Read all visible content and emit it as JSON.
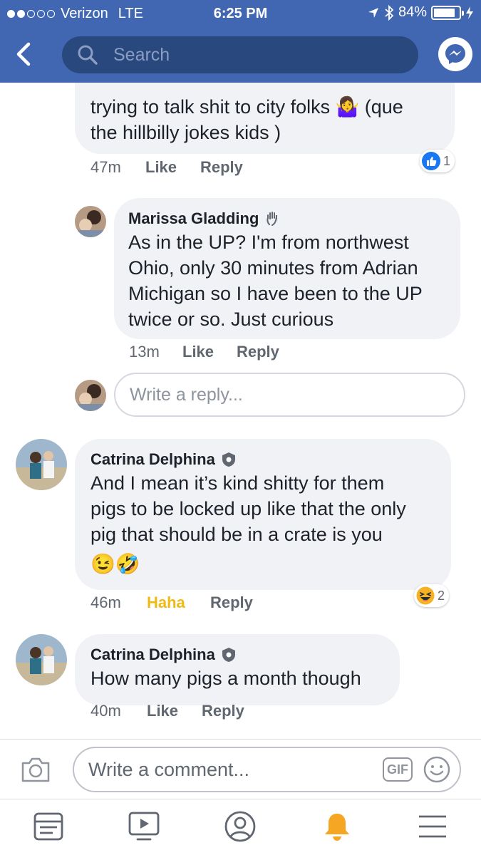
{
  "status_bar": {
    "carrier": "Verizon",
    "network": "LTE",
    "time": "6:25 PM",
    "battery": "84%",
    "battery_level": 0.84
  },
  "search": {
    "placeholder": "Search"
  },
  "comments": [
    {
      "id": "partial",
      "text_line1": "trying to talk shit to city folks 🤷‍♀️ (que",
      "text_line2": "the hillbilly jokes kids )",
      "time": "47m",
      "like_label": "Like",
      "reply_label": "Reply",
      "reaction_icon": "like-icon",
      "reaction_count": "1"
    },
    {
      "id": "marissa",
      "author": "Marissa Gladding",
      "author_badge": "wave-hand-icon",
      "text_lines": [
        "As in the UP? I'm from northwest",
        "Ohio, only 30 minutes from Adrian",
        "Michigan so I have been to the UP",
        "twice or so. Just curious"
      ],
      "time": "13m",
      "like_label": "Like",
      "reply_label": "Reply"
    },
    {
      "id": "catrina1",
      "author": "Catrina Delphina",
      "author_badge": "verified-shield-icon",
      "text_lines": [
        "And I mean it’s kind shitty for them",
        "pigs to be locked up like that the only",
        "pig that should be in a crate is you"
      ],
      "emojis": "😉🤣",
      "time": "46m",
      "like_label": "Haha",
      "reply_label": "Reply",
      "reaction_icon": "haha-icon",
      "reaction_count": "2"
    },
    {
      "id": "catrina2",
      "author": "Catrina Delphina",
      "author_badge": "verified-shield-icon",
      "text_lines": [
        "How many pigs a month though"
      ],
      "time": "40m",
      "like_label": "Like",
      "reply_label": "Reply"
    }
  ],
  "reply_input": {
    "placeholder": "Write a reply..."
  },
  "composer": {
    "placeholder": "Write a comment...",
    "gif_label": "GIF"
  },
  "tabs": [
    {
      "name": "news-feed",
      "icon": "news-feed-icon"
    },
    {
      "name": "watch",
      "icon": "video-icon"
    },
    {
      "name": "profile",
      "icon": "profile-icon"
    },
    {
      "name": "notifications",
      "icon": "bell-icon",
      "active": true
    },
    {
      "name": "menu",
      "icon": "menu-icon"
    }
  ],
  "colors": {
    "header_bg": "#4267b2",
    "search_bg": "#29487d",
    "bubble_bg": "#f1f2f6",
    "haha": "#f0ba15",
    "notification_bell": "#f5a623"
  }
}
